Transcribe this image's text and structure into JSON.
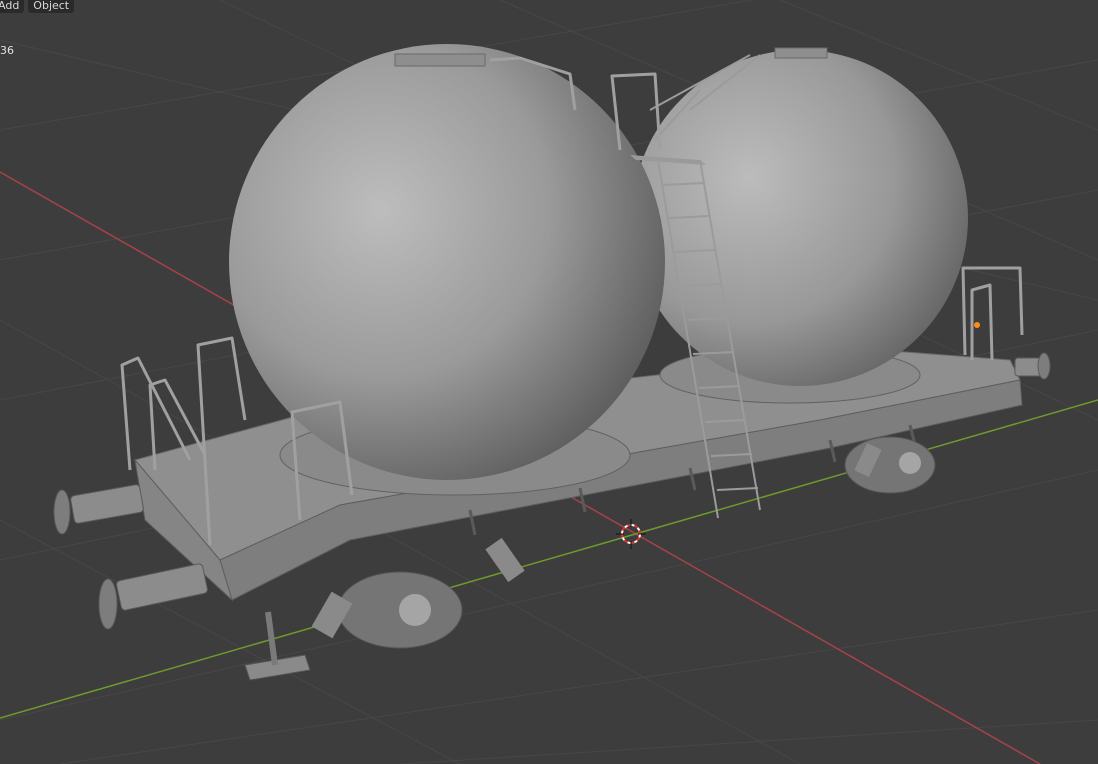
{
  "header": {
    "menu": [
      {
        "label": "Add"
      },
      {
        "label": "Object"
      }
    ]
  },
  "viewport": {
    "overlay_text": "36"
  },
  "colors": {
    "background": "#3d3d3d",
    "grid": "#4a4a4a",
    "x_axis": "#a8414a",
    "y_axis": "#6e9a2e",
    "mesh": "#8e8e8e",
    "origin_dot": "#ff8c1a"
  }
}
